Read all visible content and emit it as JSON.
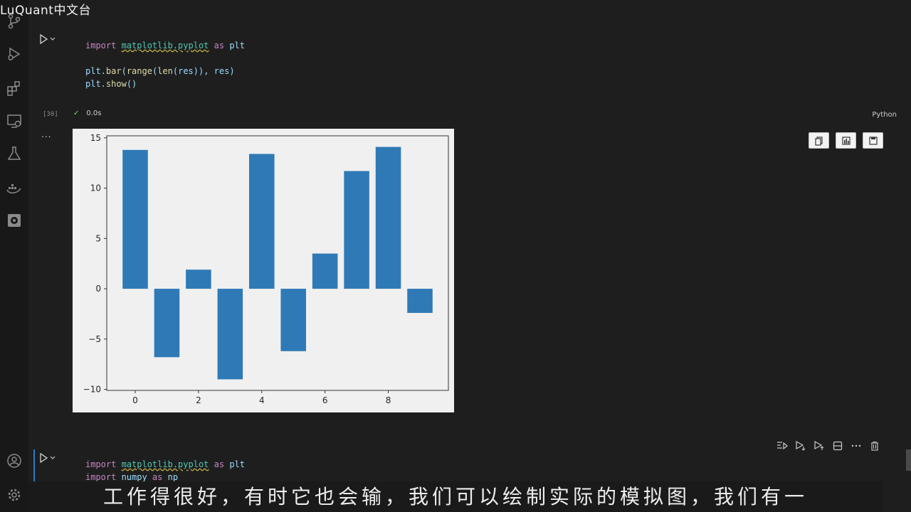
{
  "watermark": "LuQuant中文台",
  "cells": [
    {
      "code_lines": [
        {
          "parts": [
            {
              "t": "kw",
              "v": "import "
            },
            {
              "t": "mod",
              "v": "matplotlib.pyplot"
            },
            {
              "t": "kw",
              "v": " as "
            },
            {
              "t": "plain",
              "v": "plt"
            }
          ]
        },
        {
          "parts": []
        },
        {
          "parts": [
            {
              "t": "plain",
              "v": "plt."
            },
            {
              "t": "fn",
              "v": "bar"
            },
            {
              "t": "plain",
              "v": "("
            },
            {
              "t": "fn",
              "v": "range"
            },
            {
              "t": "plain",
              "v": "("
            },
            {
              "t": "fn",
              "v": "len"
            },
            {
              "t": "plain",
              "v": "(res)), res)"
            }
          ]
        },
        {
          "parts": [
            {
              "t": "plain",
              "v": "plt."
            },
            {
              "t": "fn",
              "v": "show"
            },
            {
              "t": "plain",
              "v": "()"
            }
          ]
        }
      ],
      "execution_count": "[30]",
      "status_time": "0.0s",
      "language": "Python",
      "output_dots": "..."
    },
    {
      "code_lines": [
        {
          "parts": [
            {
              "t": "kw",
              "v": "import "
            },
            {
              "t": "mod",
              "v": "matplotlib.pyplot"
            },
            {
              "t": "kw",
              "v": " as "
            },
            {
              "t": "plain",
              "v": "plt"
            }
          ]
        },
        {
          "parts": [
            {
              "t": "kw",
              "v": "import "
            },
            {
              "t": "plain",
              "v": "numpy"
            },
            {
              "t": "kw",
              "v": " as "
            },
            {
              "t": "plain",
              "v": "np"
            }
          ]
        }
      ]
    }
  ],
  "subtitle": "工作得很好，有时它也会输，我们可以绘制实际的模拟图，我们有一",
  "colors": {
    "bar": "#2f7ab6",
    "accent": "#2b79d0"
  },
  "icons": {
    "activity": [
      "source-control-icon",
      "run-debug-icon",
      "extensions-icon",
      "remote-explorer-icon",
      "testing-icon",
      "docker-icon",
      "jupyter-icon",
      "account-icon",
      "settings-gear-icon"
    ],
    "output_tools": [
      "copy-icon",
      "chart-icon",
      "save-icon"
    ],
    "cell_toolbar": [
      "execute-above-icon",
      "execute-below-icon",
      "execute-cell-icon",
      "split-cell-icon",
      "more-icon",
      "delete-icon"
    ]
  },
  "chart_data": {
    "type": "bar",
    "x": [
      0,
      1,
      2,
      3,
      4,
      5,
      6,
      7,
      8,
      9
    ],
    "values": [
      13.8,
      -6.8,
      1.9,
      -9.0,
      13.4,
      -6.2,
      3.5,
      11.7,
      14.1,
      -2.4
    ],
    "title": "",
    "xlabel": "",
    "ylabel": "",
    "xticks": [
      0,
      2,
      4,
      6,
      8
    ],
    "yticks": [
      -10,
      -5,
      0,
      5,
      10,
      15
    ],
    "xlim": [
      -0.9,
      9.9
    ],
    "ylim": [
      -10.1,
      15.2
    ],
    "grid": false
  }
}
